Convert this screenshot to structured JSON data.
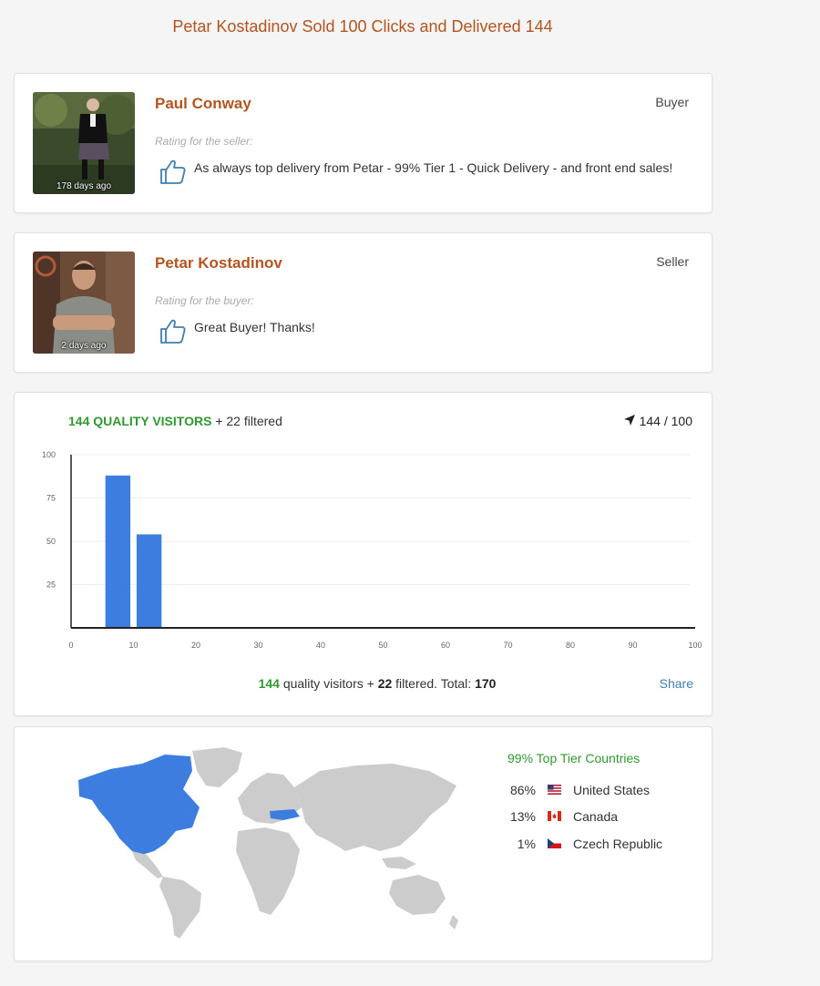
{
  "page": {
    "title": "Petar Kostadinov Sold 100 Clicks and Delivered 144"
  },
  "reviews": [
    {
      "name": "Paul Conway",
      "role": "Buyer",
      "rating_label": "Rating for the seller:",
      "text": "As always top delivery from Petar - 99% Tier 1 - Quick Delivery - and front end sales!",
      "ago": "178 days ago",
      "thumb_icon": "thumbs-up-icon"
    },
    {
      "name": "Petar Kostadinov",
      "role": "Seller",
      "rating_label": "Rating for the buyer:",
      "text": "Great Buyer! Thanks!",
      "ago": "2 days ago",
      "thumb_icon": "thumbs-up-icon"
    }
  ],
  "visitors": {
    "quality_label": "144 QUALITY VISITORS",
    "filtered_label": "+ 22 filtered",
    "clicks": "144 / 100",
    "clicks_icon": "navigation-arrow-icon",
    "summary": {
      "quality": "144",
      "quality_text": "quality visitors +",
      "filtered": "22",
      "filtered_text": "filtered. Total:",
      "total": "170"
    },
    "share_label": "Share"
  },
  "chart_data": {
    "type": "bar",
    "x": [
      7.5,
      12.5
    ],
    "values": [
      88,
      54
    ],
    "bin_width": 4,
    "xlim": [
      0,
      100
    ],
    "ylim": [
      0,
      100
    ],
    "xticks": [
      0,
      10,
      20,
      30,
      40,
      50,
      60,
      70,
      80,
      90,
      100
    ],
    "yticks": [
      25,
      50,
      75,
      100
    ],
    "grid": true,
    "color": "#3c7ddf"
  },
  "countries": {
    "title": "99% Top Tier Countries",
    "items": [
      {
        "pct": "86%",
        "name": "United States",
        "flag": "us-flag-icon"
      },
      {
        "pct": "13%",
        "name": "Canada",
        "flag": "canada-flag-icon"
      },
      {
        "pct": "1%",
        "name": "Czech Republic",
        "flag": "czech-flag-icon"
      }
    ],
    "highlight_color": "#3c7ddf",
    "land_color": "#cccccc"
  }
}
